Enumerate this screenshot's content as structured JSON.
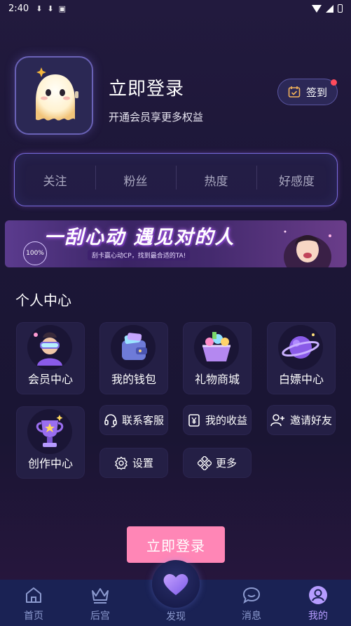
{
  "status_bar": {
    "time": "2:40"
  },
  "profile": {
    "login_title": "立即登录",
    "subtitle": "开通会员享更多权益",
    "checkin_label": "签到"
  },
  "stats": [
    "关注",
    "粉丝",
    "热度",
    "好感度"
  ],
  "banner": {
    "title": "一刮心动 遇见对的人",
    "subtitle": "刮卡赢心动CP，找到最合适的TA!",
    "badge": "100%"
  },
  "section": {
    "title": "个人中心"
  },
  "grid": {
    "vip_center": "会员中心",
    "wallet": "我的钱包",
    "gift_mall": "礼物商城",
    "free_center": "白嫖中心",
    "creator_center": "创作中心",
    "customer_service": "联系客服",
    "earnings": "我的收益",
    "invite_friends": "邀请好友",
    "settings": "设置",
    "more": "更多"
  },
  "cta": {
    "label": "立即登录"
  },
  "tabbar": {
    "home": "首页",
    "harem": "后宫",
    "discover": "发现",
    "messages": "消息",
    "mine": "我的"
  },
  "colors": {
    "accent_pink": "#ff86b6",
    "tab_active": "#b59cff",
    "tab_bg": "#1a2254"
  }
}
